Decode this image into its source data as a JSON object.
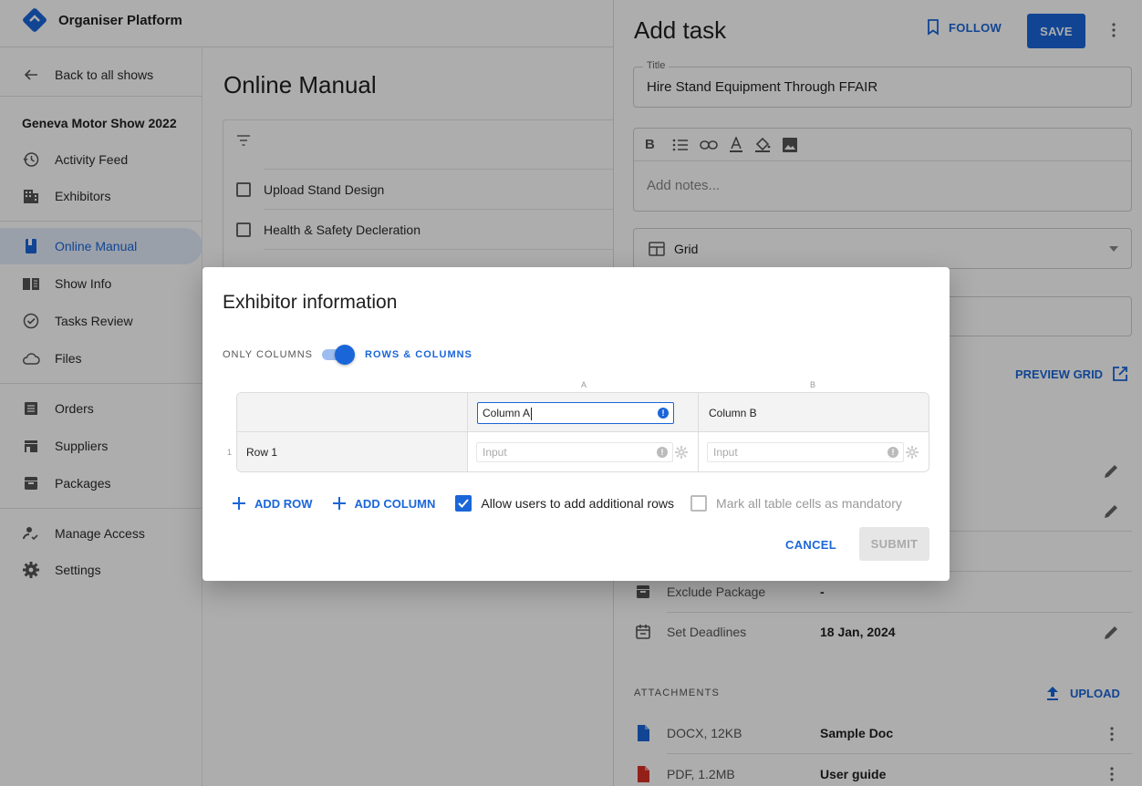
{
  "app": {
    "title": "Organiser Platform"
  },
  "sidebar": {
    "back_label": "Back to all shows",
    "show_name": "Geneva Motor Show 2022",
    "items": [
      {
        "label": "Activity Feed",
        "icon": "history-icon"
      },
      {
        "label": "Exhibitors",
        "icon": "building-icon"
      },
      {
        "label": "Online Manual",
        "icon": "book-icon",
        "active": true
      },
      {
        "label": "Show Info",
        "icon": "open-book-icon"
      },
      {
        "label": "Tasks Review",
        "icon": "check-circle-icon"
      },
      {
        "label": "Files",
        "icon": "cloud-icon"
      },
      {
        "label": "Orders",
        "icon": "list-icon"
      },
      {
        "label": "Suppliers",
        "icon": "store-icon"
      },
      {
        "label": "Packages",
        "icon": "archive-icon"
      },
      {
        "label": "Manage Access",
        "icon": "user-check-icon"
      },
      {
        "label": "Settings",
        "icon": "gear-icon"
      }
    ]
  },
  "main": {
    "title": "Online Manual",
    "tasks": [
      "Upload Stand Design",
      "Health & Safety Decleration"
    ]
  },
  "drawer": {
    "title": "Add task",
    "follow_label": "FOLLOW",
    "save_label": "SAVE",
    "title_field": {
      "legend": "Title",
      "value": "Hire Stand Equipment Through FFAIR"
    },
    "notes_placeholder": "Add notes...",
    "type_select": "Grid",
    "preview_grid_label": "PREVIEW GRID",
    "properties": [
      {
        "label": "Exclude Package",
        "value": "-"
      },
      {
        "label": "Set Deadlines",
        "value": "18 Jan, 2024"
      }
    ],
    "attachments_heading": "ATTACHMENTS",
    "upload_label": "UPLOAD",
    "attachments": [
      {
        "meta": "DOCX, 12KB",
        "name": "Sample Doc"
      },
      {
        "meta": "PDF, 1.2MB",
        "name": "User guide"
      }
    ]
  },
  "modal": {
    "title": "Exhibitor information",
    "toggle_left": "ONLY COLUMNS",
    "toggle_right": "ROWS & COLUMNS",
    "col_letters": [
      "A",
      "B"
    ],
    "col_a_value": "Column A",
    "col_b_value": "Column B",
    "row_label": "Row 1",
    "row_number": "1",
    "cell_placeholder": "Input",
    "add_row_label": "ADD ROW",
    "add_column_label": "ADD COLUMN",
    "allow_rows_label": "Allow users to add additional rows",
    "mandatory_label": "Mark all table cells as mandatory",
    "allow_rows_checked": true,
    "mandatory_checked": false,
    "cancel_label": "CANCEL",
    "submit_label": "SUBMIT"
  },
  "colors": {
    "accent": "#1a66d9",
    "scrim": "rgba(0,0,0,0.32)",
    "attachment_doc": "#1a66d9",
    "attachment_pdf": "#d93025"
  }
}
